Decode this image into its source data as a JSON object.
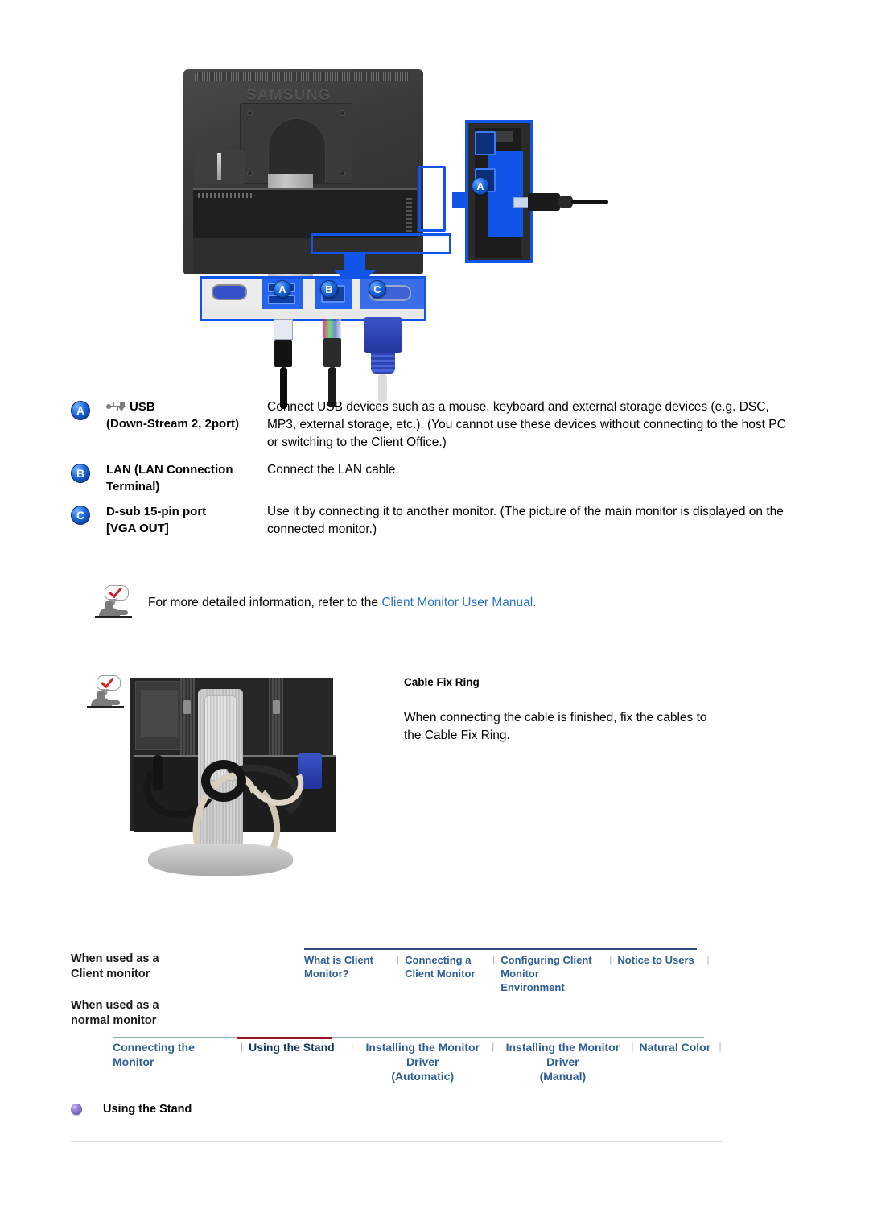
{
  "figure_top": {
    "alt": "Rear of Samsung LCD monitor showing USB, LAN and D-sub VGA OUT ports with callouts",
    "brand_logo": "SAMSUNG",
    "badges": {
      "a": "A",
      "b": "B",
      "c": "C"
    },
    "detail_badge": "A"
  },
  "legend": {
    "rows": [
      {
        "badge": "A",
        "icon": "usb-icon",
        "term_line1": "USB",
        "term_line2": "(Down-Stream 2, 2port)",
        "desc": "Connect USB devices such as a mouse, keyboard and external storage devices (e.g. DSC, MP3, external storage, etc.).\n(You cannot use these devices without connecting to the host PC or switching to the Client Office.)"
      },
      {
        "badge": "B",
        "term_line1": "LAN (LAN Connection",
        "term_line2": "Terminal)",
        "desc": "Connect the LAN cable."
      },
      {
        "badge": "C",
        "term_line1": "D-sub 15-pin port",
        "term_line2": "[VGA OUT]",
        "desc": "Use it by connecting it to another monitor.\n(The picture of the main monitor is displayed on the connected monitor.)"
      }
    ]
  },
  "note_1": {
    "icon": "note-person-icon",
    "text_before": "For more detailed information, refer to the ",
    "link_text": "Client Monitor User Manual."
  },
  "cable_fix_ring": {
    "icon": "note-person-icon",
    "figure_alt": "Rear view of monitor stand with cables routed through the Cable Fix Ring",
    "title": "Cable Fix Ring",
    "body": "When connecting the cable is finished, fix the cables to the Cable Fix Ring."
  },
  "footer_nav": {
    "row1_label_line1": "When used as a",
    "row1_label_line2": "Client monitor",
    "row2_label_line1": "When used as a",
    "row2_label_line2": "normal monitor",
    "row1_items": [
      {
        "line1": "What is Client",
        "line2": "Monitor?",
        "active": false
      },
      {
        "line1": "Connecting a",
        "line2": "Client Monitor",
        "active": false
      },
      {
        "line1": "Configuring  Client",
        "line2": "Monitor  Environment",
        "active": false
      },
      {
        "line1": "Notice to Users",
        "line2": "",
        "active": false
      }
    ],
    "row2_items": [
      {
        "line1": "Connecting  the Monitor",
        "line2": "",
        "active": false
      },
      {
        "line1": "Using the Stand",
        "line2": "",
        "active": true
      },
      {
        "line1": "Installing the Monitor Driver",
        "line2": "(Automatic)",
        "active": false
      },
      {
        "line1": "Installing the Monitor Driver",
        "line2": "(Manual)",
        "active": false
      },
      {
        "line1": "Natural Color",
        "line2": "",
        "active": false
      }
    ],
    "separator": "|",
    "accent_color": "#9e1623",
    "link_color": "#2e5e96"
  },
  "section_heading": {
    "bullet": "purple-orb-bullet",
    "title": "Using the Stand"
  }
}
